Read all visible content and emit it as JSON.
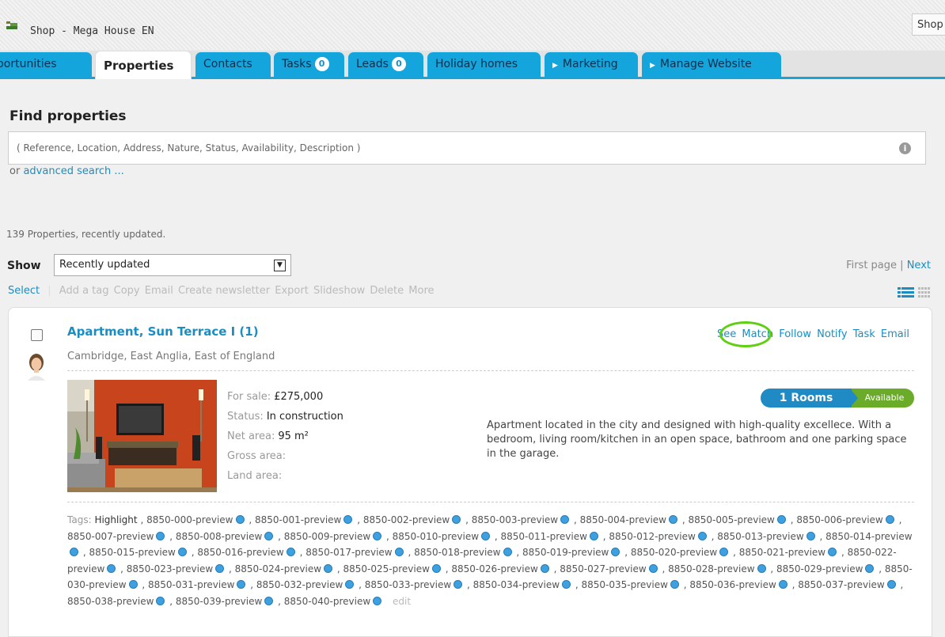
{
  "app": {
    "title": "Shop - Mega House EN",
    "shop_button": "Shop"
  },
  "tabs": [
    {
      "label": "Opportunities",
      "active": false
    },
    {
      "label": "Properties",
      "active": true
    },
    {
      "label": "Contacts",
      "active": false
    },
    {
      "label": "Tasks",
      "badge": "0",
      "active": false
    },
    {
      "label": "Leads",
      "badge": "0",
      "active": false
    },
    {
      "label": "Holiday homes",
      "active": false
    },
    {
      "label": "Marketing",
      "active": false,
      "submenu": true
    },
    {
      "label": "Manage Website",
      "active": false,
      "submenu": true
    }
  ],
  "search": {
    "heading": "Find properties",
    "placeholder": "( Reference, Location, Address, Nature, Status, Availability, Description )",
    "advanced_prefix": "or",
    "advanced_link": "advanced search ..."
  },
  "results": {
    "count_text": "139 Properties, recently updated.",
    "show_label": "Show",
    "show_value": "Recently updated",
    "pager": {
      "first": "First page",
      "sep": "|",
      "next": "Next"
    }
  },
  "actions": {
    "select": "Select",
    "items": [
      "Add a tag",
      "Copy",
      "Email",
      "Create newsletter",
      "Export",
      "Slideshow",
      "Delete",
      "More"
    ]
  },
  "property": {
    "title": "Apartment, Sun Terrace I (1)",
    "location": "Cambridge, East Anglia, East of England",
    "links": [
      "See",
      "Match",
      "Follow",
      "Notify",
      "Task",
      "Email"
    ],
    "facts": [
      {
        "label": "For sale:",
        "value": "£275,000"
      },
      {
        "label": "Status:",
        "value": "In construction"
      },
      {
        "label": "Net area:",
        "value": "95 m²"
      },
      {
        "label": "Gross area:",
        "value": ""
      },
      {
        "label": "Land area:",
        "value": ""
      }
    ],
    "rooms": "1 Rooms",
    "availability": "Available",
    "description": "Apartment located in the city and designed with high-quality excellece. With a bedroom, living room/kitchen in an open space, bathroom and one parking space in the garage.",
    "tags_label": "Tags:",
    "tags": [
      "Highlight",
      "8850-000-preview",
      "8850-001-preview",
      "8850-002-preview",
      "8850-003-preview",
      "8850-004-preview",
      "8850-005-preview",
      "8850-006-preview",
      "8850-007-preview",
      "8850-008-preview",
      "8850-009-preview",
      "8850-010-preview",
      "8850-011-preview",
      "8850-012-preview",
      "8850-013-preview",
      "8850-014-preview",
      "8850-015-preview",
      "8850-016-preview",
      "8850-017-preview",
      "8850-018-preview",
      "8850-019-preview",
      "8850-020-preview",
      "8850-021-preview",
      "8850-022-preview",
      "8850-023-preview",
      "8850-024-preview",
      "8850-025-preview",
      "8850-026-preview",
      "8850-027-preview",
      "8850-028-preview",
      "8850-029-preview",
      "8850-030-preview",
      "8850-031-preview",
      "8850-032-preview",
      "8850-033-preview",
      "8850-034-preview",
      "8850-035-preview",
      "8850-036-preview",
      "8850-037-preview",
      "8850-038-preview",
      "8850-039-preview",
      "8850-040-preview"
    ],
    "tags_edit": "edit"
  },
  "colors": {
    "accent": "#14a5dd",
    "link": "#1a8ec2",
    "available": "#6aab2a",
    "rooms": "#1f8ac4",
    "highlight_ring": "#5ecf11"
  }
}
